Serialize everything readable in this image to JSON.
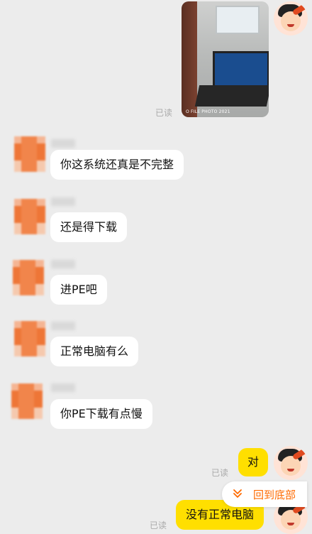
{
  "colors": {
    "background": "#ececec",
    "incoming_bubble": "#ffffff",
    "outgoing_bubble": "#ffdf00",
    "accent": "#ff6a00"
  },
  "photo_message": {
    "caption": "O FILE PHOTO 2021",
    "read_status": "已读"
  },
  "messages": [
    {
      "text": "你这系统还真是不完整"
    },
    {
      "text": "还是得下载"
    },
    {
      "text": "进PE吧"
    },
    {
      "text": "正常电脑有么"
    },
    {
      "text": "你PE下载有点慢"
    }
  ],
  "outgoing": [
    {
      "text": "对",
      "read_status": "已读"
    },
    {
      "text": "没有正常电脑",
      "read_status": "已读"
    }
  ],
  "jump_to_bottom": {
    "label": "回到底部",
    "icon": "double-chevron-down-icon"
  }
}
